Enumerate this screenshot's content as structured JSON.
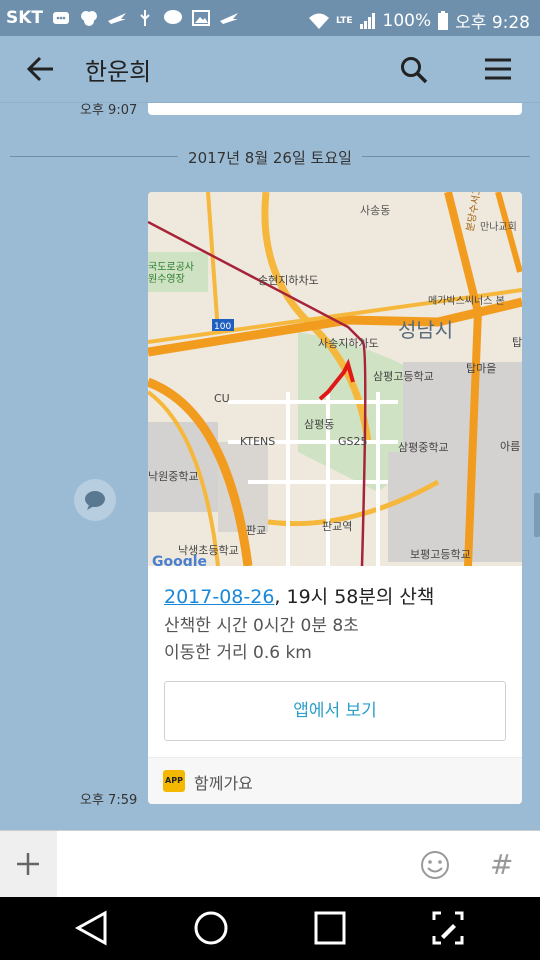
{
  "statusbar": {
    "carrier": "SKT",
    "battery": "100%",
    "time": "오후 9:28",
    "network": "LTE"
  },
  "header": {
    "title": "한운희"
  },
  "chat": {
    "prev_time": "오후 9:07",
    "date_divider": "2017년 8월 26일 토요일",
    "card": {
      "date_link": "2017-08-26",
      "title_rest": ", 19시 58분의 산책",
      "line_time": "산책한 시간 0시간 0분 8초",
      "line_distance": "이동한 거리 0.6 km",
      "button": "앱에서 보기",
      "app_badge": "APP",
      "app_name": "함께가요"
    },
    "card_time": "오후 7:59"
  },
  "map_labels": {
    "sasong": "사송동",
    "manna": "만나교회",
    "gukdo": "국도로공사",
    "wonsu": "원수영장",
    "songhyeon": "송현지하차도",
    "megabox": "메가박스씨너스 본",
    "tap": "탑",
    "r100": "100",
    "sasong_tunnel": "사송지하차도",
    "seongnam": "성남시",
    "sampyeong_hs": "삼평고등학교",
    "tapmaeul": "탑마을",
    "cu": "CU",
    "sampyeong": "삼평동",
    "ktens": "KTENS",
    "gs25": "GS25",
    "sampyeong_ms": "삼평중학교",
    "areum": "아름",
    "nakwon_ms": "낙원중학교",
    "pangyo": "판교",
    "pangyo_st": "판교역",
    "nakseong": "낙생초등학교",
    "bopyeong": "보평고등학교",
    "google": "Google",
    "bundang_road": "분당수서고속화도로"
  },
  "input": {
    "placeholder": ""
  },
  "colors": {
    "chat_bg": "#9bbbd4",
    "link": "#1a88d8",
    "accent": "#2ca0c8",
    "route": "#e02020",
    "status_bar": "#6f90ad"
  }
}
